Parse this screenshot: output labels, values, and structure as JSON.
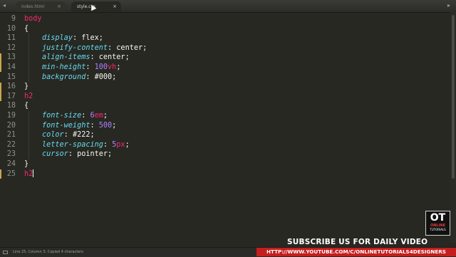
{
  "tabs": [
    {
      "label": "index.html",
      "active": false
    },
    {
      "label": "style.css",
      "active": true
    }
  ],
  "tab_close_glyph": "×",
  "nav_left_glyph": "◂",
  "nav_right_glyph": "▸",
  "lines": [
    {
      "num": "9",
      "tokens": [
        {
          "t": "sel",
          "v": "body"
        }
      ]
    },
    {
      "num": "10",
      "tokens": [
        {
          "t": "punc",
          "v": "{"
        }
      ]
    },
    {
      "num": "11",
      "tokens": [
        {
          "t": "prop",
          "v": "display"
        },
        {
          "t": "punc",
          "v": ": "
        },
        {
          "t": "val",
          "v": "flex"
        },
        {
          "t": "punc",
          "v": ";"
        }
      ]
    },
    {
      "num": "12",
      "tokens": [
        {
          "t": "prop",
          "v": "justify-content"
        },
        {
          "t": "punc",
          "v": ": "
        },
        {
          "t": "val",
          "v": "center"
        },
        {
          "t": "punc",
          "v": ";"
        }
      ]
    },
    {
      "num": "13",
      "tokens": [
        {
          "t": "prop",
          "v": "align-items"
        },
        {
          "t": "punc",
          "v": ": "
        },
        {
          "t": "val",
          "v": "center"
        },
        {
          "t": "punc",
          "v": ";"
        }
      ]
    },
    {
      "num": "14",
      "tokens": [
        {
          "t": "prop",
          "v": "min-height"
        },
        {
          "t": "punc",
          "v": ": "
        },
        {
          "t": "num",
          "v": "100"
        },
        {
          "t": "unit",
          "v": "vh"
        },
        {
          "t": "punc",
          "v": ";"
        }
      ]
    },
    {
      "num": "15",
      "tokens": [
        {
          "t": "prop",
          "v": "background"
        },
        {
          "t": "punc",
          "v": ": "
        },
        {
          "t": "val",
          "v": "#000"
        },
        {
          "t": "punc",
          "v": ";"
        }
      ]
    },
    {
      "num": "16",
      "tokens": [
        {
          "t": "punc",
          "v": "}"
        }
      ]
    },
    {
      "num": "17",
      "tokens": [
        {
          "t": "sel",
          "v": "h2"
        }
      ]
    },
    {
      "num": "18",
      "tokens": [
        {
          "t": "punc",
          "v": "{"
        }
      ]
    },
    {
      "num": "19",
      "tokens": [
        {
          "t": "prop",
          "v": "font-size"
        },
        {
          "t": "punc",
          "v": ": "
        },
        {
          "t": "num",
          "v": "6"
        },
        {
          "t": "unit",
          "v": "em"
        },
        {
          "t": "punc",
          "v": ";"
        }
      ]
    },
    {
      "num": "20",
      "tokens": [
        {
          "t": "prop",
          "v": "font-weight"
        },
        {
          "t": "punc",
          "v": ": "
        },
        {
          "t": "num",
          "v": "500"
        },
        {
          "t": "punc",
          "v": ";"
        }
      ]
    },
    {
      "num": "21",
      "tokens": [
        {
          "t": "prop",
          "v": "color"
        },
        {
          "t": "punc",
          "v": ": "
        },
        {
          "t": "val",
          "v": "#222"
        },
        {
          "t": "punc",
          "v": ";"
        }
      ]
    },
    {
      "num": "22",
      "tokens": [
        {
          "t": "prop",
          "v": "letter-spacing"
        },
        {
          "t": "punc",
          "v": ": "
        },
        {
          "t": "num",
          "v": "5"
        },
        {
          "t": "unit",
          "v": "px"
        },
        {
          "t": "punc",
          "v": ";"
        }
      ]
    },
    {
      "num": "23",
      "tokens": [
        {
          "t": "prop",
          "v": "cursor"
        },
        {
          "t": "punc",
          "v": ": "
        },
        {
          "t": "val",
          "v": "pointer"
        },
        {
          "t": "punc",
          "v": ";"
        }
      ]
    },
    {
      "num": "24",
      "tokens": [
        {
          "t": "punc",
          "v": "}"
        }
      ]
    },
    {
      "num": "25",
      "tokens": [
        {
          "t": "sel",
          "v": "h2"
        }
      ]
    }
  ],
  "status": {
    "text": "Line 25, Column 3; Copied 4 characters"
  },
  "overlay": {
    "subscribe": "SUBSCRIBE US FOR DAILY VIDEO",
    "url": "HTTP://WWW.YOUTUBE.COM/C/ONLINETUTORIALS4DESIGNERS",
    "logo_ot": "OT",
    "logo_online": "ONLINE",
    "logo_tutorials": "TUTORIALS"
  },
  "colors": {
    "background": "#272822",
    "selector": "#f92672",
    "property": "#66d9ef",
    "number": "#ae81ff",
    "text": "#f8f8f2",
    "banner": "#c41e1e"
  }
}
